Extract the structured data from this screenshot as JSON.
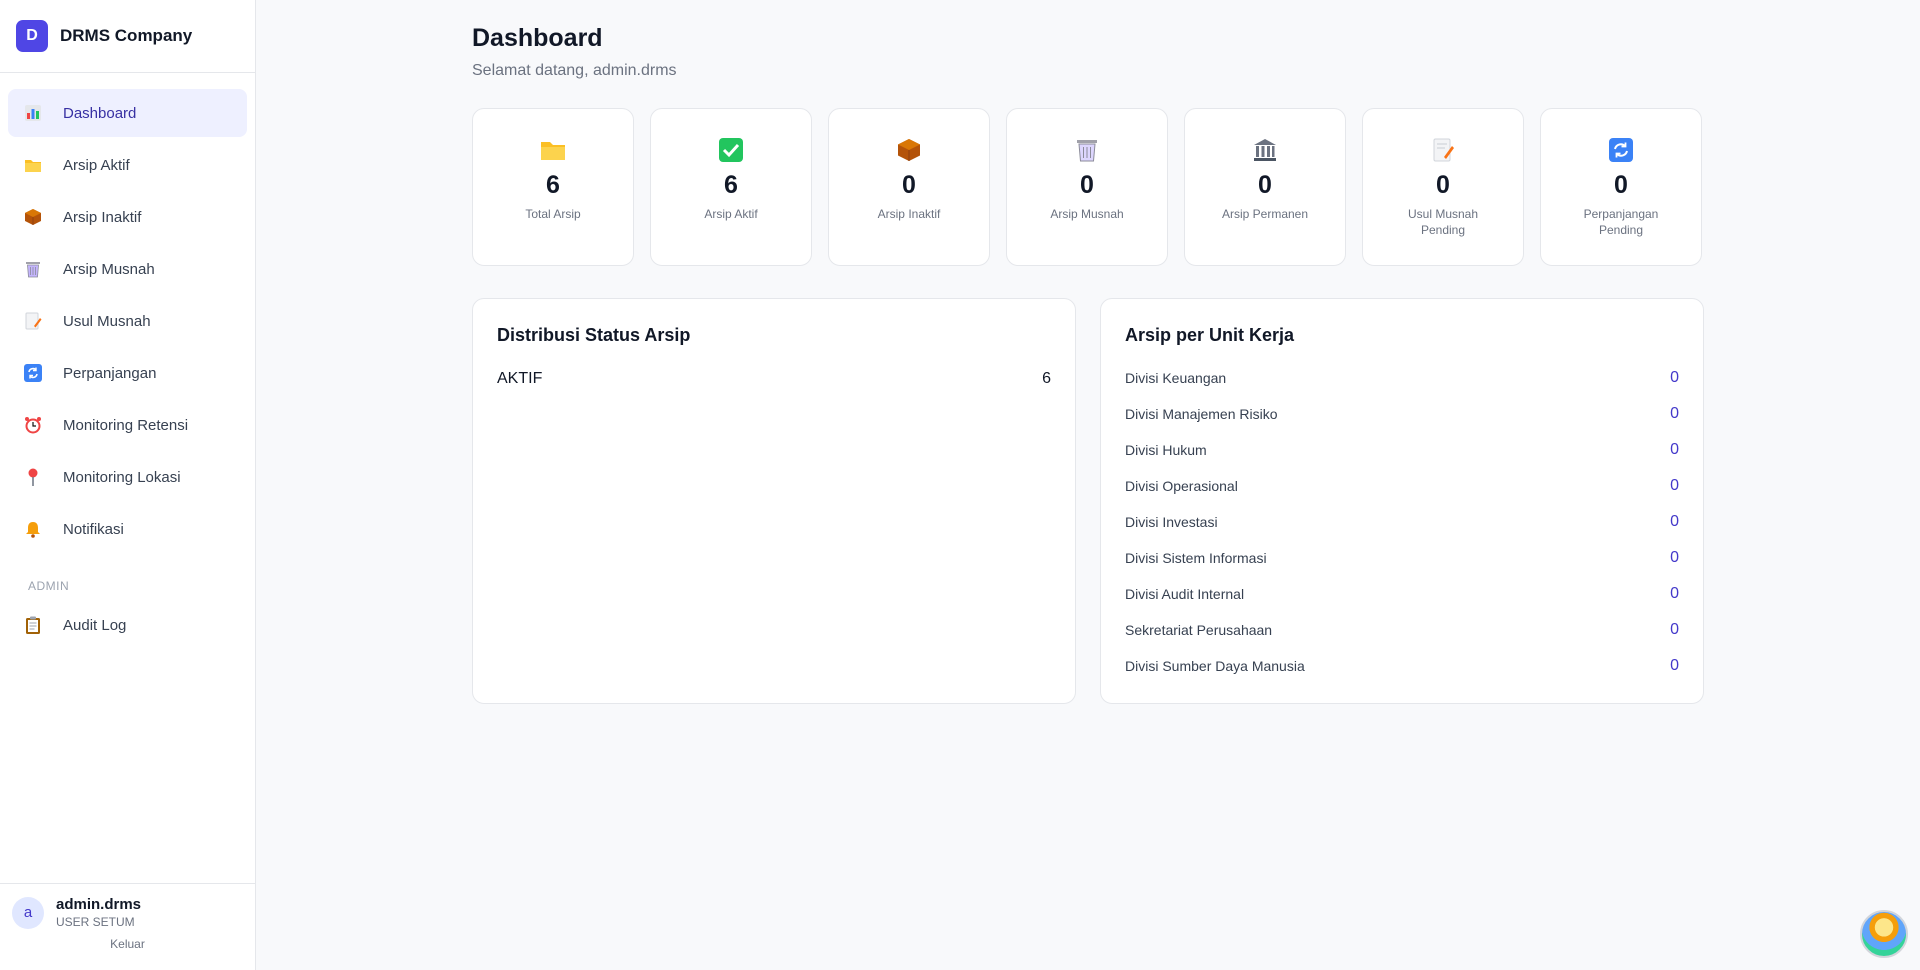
{
  "brand": {
    "logo_letter": "D",
    "name": "DRMS Company",
    "logo_color": "#4f46e5"
  },
  "sidebar": {
    "items": [
      {
        "label": "Dashboard",
        "icon": "bar-chart-icon",
        "active": true
      },
      {
        "label": "Arsip Aktif",
        "icon": "folder-icon"
      },
      {
        "label": "Arsip Inaktif",
        "icon": "package-icon"
      },
      {
        "label": "Arsip Musnah",
        "icon": "trash-icon"
      },
      {
        "label": "Usul Musnah",
        "icon": "memo-icon"
      },
      {
        "label": "Perpanjangan",
        "icon": "refresh-icon"
      },
      {
        "label": "Monitoring Retensi",
        "icon": "alarm-clock-icon"
      },
      {
        "label": "Monitoring Lokasi",
        "icon": "pin-icon"
      },
      {
        "label": "Notifikasi",
        "icon": "bell-icon"
      }
    ],
    "admin_section_label": "ADMIN",
    "admin_items": [
      {
        "label": "Audit Log",
        "icon": "clipboard-icon"
      }
    ]
  },
  "user": {
    "avatar_letter": "a",
    "name": "admin.drms",
    "role": "USER SETUM",
    "logout_label": "Keluar"
  },
  "header": {
    "title": "Dashboard",
    "subtitle": "Selamat datang, admin.drms"
  },
  "stats": [
    {
      "value": "6",
      "label": "Total Arsip",
      "icon": "folder-icon"
    },
    {
      "value": "6",
      "label": "Arsip Aktif",
      "icon": "check-icon"
    },
    {
      "value": "0",
      "label": "Arsip Inaktif",
      "icon": "package-icon"
    },
    {
      "value": "0",
      "label": "Arsip Musnah",
      "icon": "trash-icon"
    },
    {
      "value": "0",
      "label": "Arsip Permanen",
      "icon": "bank-icon"
    },
    {
      "value": "0",
      "label": "Usul Musnah Pending",
      "icon": "memo-icon"
    },
    {
      "value": "0",
      "label": "Perpanjangan Pending",
      "icon": "refresh-icon"
    }
  ],
  "status_panel": {
    "title": "Distribusi Status Arsip",
    "rows": [
      {
        "label": "AKTIF",
        "value": "6"
      }
    ]
  },
  "unit_panel": {
    "title": "Arsip per Unit Kerja",
    "rows": [
      {
        "label": "Divisi Keuangan",
        "value": "0"
      },
      {
        "label": "Divisi Manajemen Risiko",
        "value": "0"
      },
      {
        "label": "Divisi Hukum",
        "value": "0"
      },
      {
        "label": "Divisi Operasional",
        "value": "0"
      },
      {
        "label": "Divisi Investasi",
        "value": "0"
      },
      {
        "label": "Divisi Sistem Informasi",
        "value": "0"
      },
      {
        "label": "Divisi Audit Internal",
        "value": "0"
      },
      {
        "label": "Sekretariat Perusahaan",
        "value": "0"
      },
      {
        "label": "Divisi Sumber Daya Manusia",
        "value": "0"
      }
    ]
  },
  "colors": {
    "accent": "#4338ca",
    "active_bg": "#eef0ff"
  }
}
